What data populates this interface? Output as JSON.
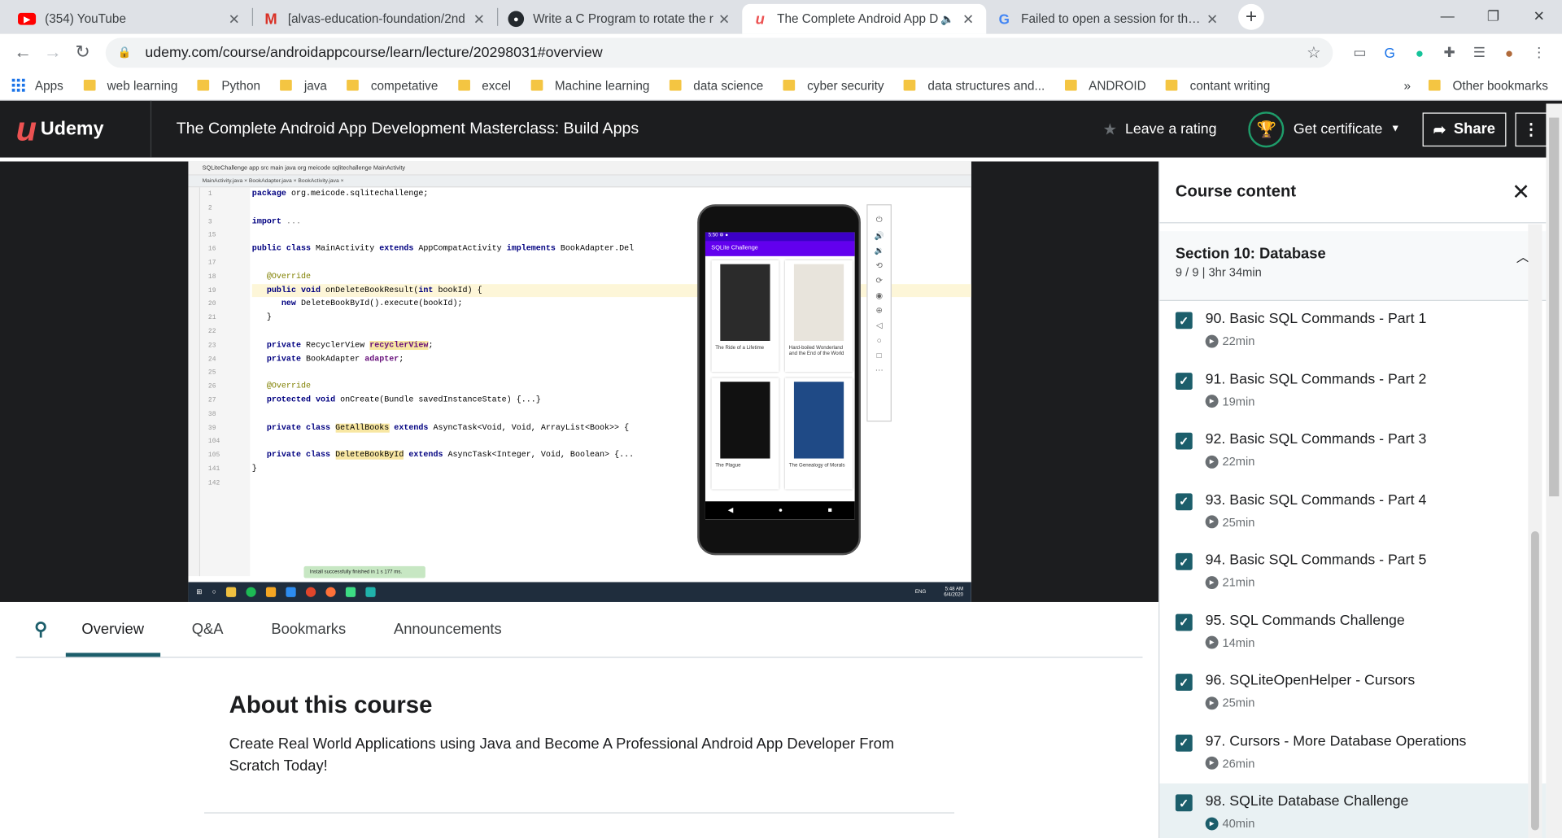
{
  "browser": {
    "tabs": [
      {
        "title": "(354) YouTube",
        "icon": "youtube-icon",
        "color": "#ff0000"
      },
      {
        "title": "[alvas-education-foundation/2nd",
        "icon": "gmail-icon",
        "color": "#d93025"
      },
      {
        "title": "Write a C Program to rotate the r",
        "icon": "github-icon",
        "color": "#24292e"
      },
      {
        "title": "The Complete Android App D",
        "icon": "udemy-icon",
        "color": "#ec5252"
      },
      {
        "title": "Failed to open a session for the v",
        "icon": "google-icon",
        "color": "#4285f4"
      }
    ],
    "url": "udemy.com/course/androidappcourse/learn/lecture/20298031#overview",
    "bookmarks": [
      "Apps",
      "web learning",
      "Python",
      "java",
      "competative",
      "excel",
      "Machine learning",
      "data science",
      "cyber security",
      "data structures and...",
      "ANDROID",
      "contant writing"
    ],
    "bookmarks_more": "»",
    "other_bookmarks": "Other bookmarks"
  },
  "header": {
    "logo": "Udemy",
    "course_title": "The Complete Android App Development Masterclass: Build Apps",
    "rating": "Leave a rating",
    "certificate": "Get certificate",
    "share": "Share"
  },
  "video": {
    "project_path": "SQLiteChallenge  app  src  main  java  org  meicode  sqlitechallenge  MainActivity",
    "file_tabs": "MainActivity.java ×   BookAdapter.java ×   BookActivity.java ×",
    "line_numbers": [
      "1",
      "2",
      "3",
      "15",
      "16",
      "17",
      "18",
      "19",
      "20",
      "21",
      "22",
      "23",
      "24",
      "25",
      "26",
      "27",
      "38",
      "39",
      "104",
      "105",
      "141",
      "142"
    ],
    "app_title": "SQLite Challenge",
    "books": [
      {
        "title": "The Ride of a Lifetime",
        "cover": "#2b2b2b"
      },
      {
        "title": "Hard-boiled Wonderland and the End of the World",
        "cover": "#e8e4dc"
      },
      {
        "title": "The Plague",
        "cover": "#111111"
      },
      {
        "title": "The Genealogy of Morals",
        "cover": "#1f4a86"
      }
    ],
    "toast": "Install successfully finished in 1 s 177 ms.",
    "clock_time": "5:48 AM",
    "clock_date": "6/4/2020",
    "lang": "ENG"
  },
  "tabs": {
    "overview": "Overview",
    "qa": "Q&A",
    "bookmarks": "Bookmarks",
    "announcements": "Announcements"
  },
  "about": {
    "heading": "About this course",
    "description": "Create Real World Applications using Java and Become A Professional Android App Developer From Scratch Today!"
  },
  "sidebar": {
    "title": "Course content",
    "section": {
      "title": "Section 10: Database",
      "meta": "9 / 9 | 3hr 34min"
    },
    "lectures": [
      {
        "title": "90. Basic SQL Commands - Part 1",
        "duration": "22min"
      },
      {
        "title": "91. Basic SQL Commands - Part 2",
        "duration": "19min"
      },
      {
        "title": "92. Basic SQL Commands - Part 3",
        "duration": "22min"
      },
      {
        "title": "93. Basic SQL Commands - Part 4",
        "duration": "25min"
      },
      {
        "title": "94. Basic SQL Commands - Part 5",
        "duration": "21min"
      },
      {
        "title": "95. SQL Commands Challenge",
        "duration": "14min"
      },
      {
        "title": "96. SQLiteOpenHelper - Cursors",
        "duration": "25min"
      },
      {
        "title": "97. Cursors - More Database Operations",
        "duration": "26min"
      },
      {
        "title": "98. SQLite Database Challenge",
        "duration": "40min"
      }
    ]
  },
  "colors": {
    "accent": "#1c5e6b",
    "brand": "#ec5252",
    "header_bg": "#1c1d1f"
  }
}
